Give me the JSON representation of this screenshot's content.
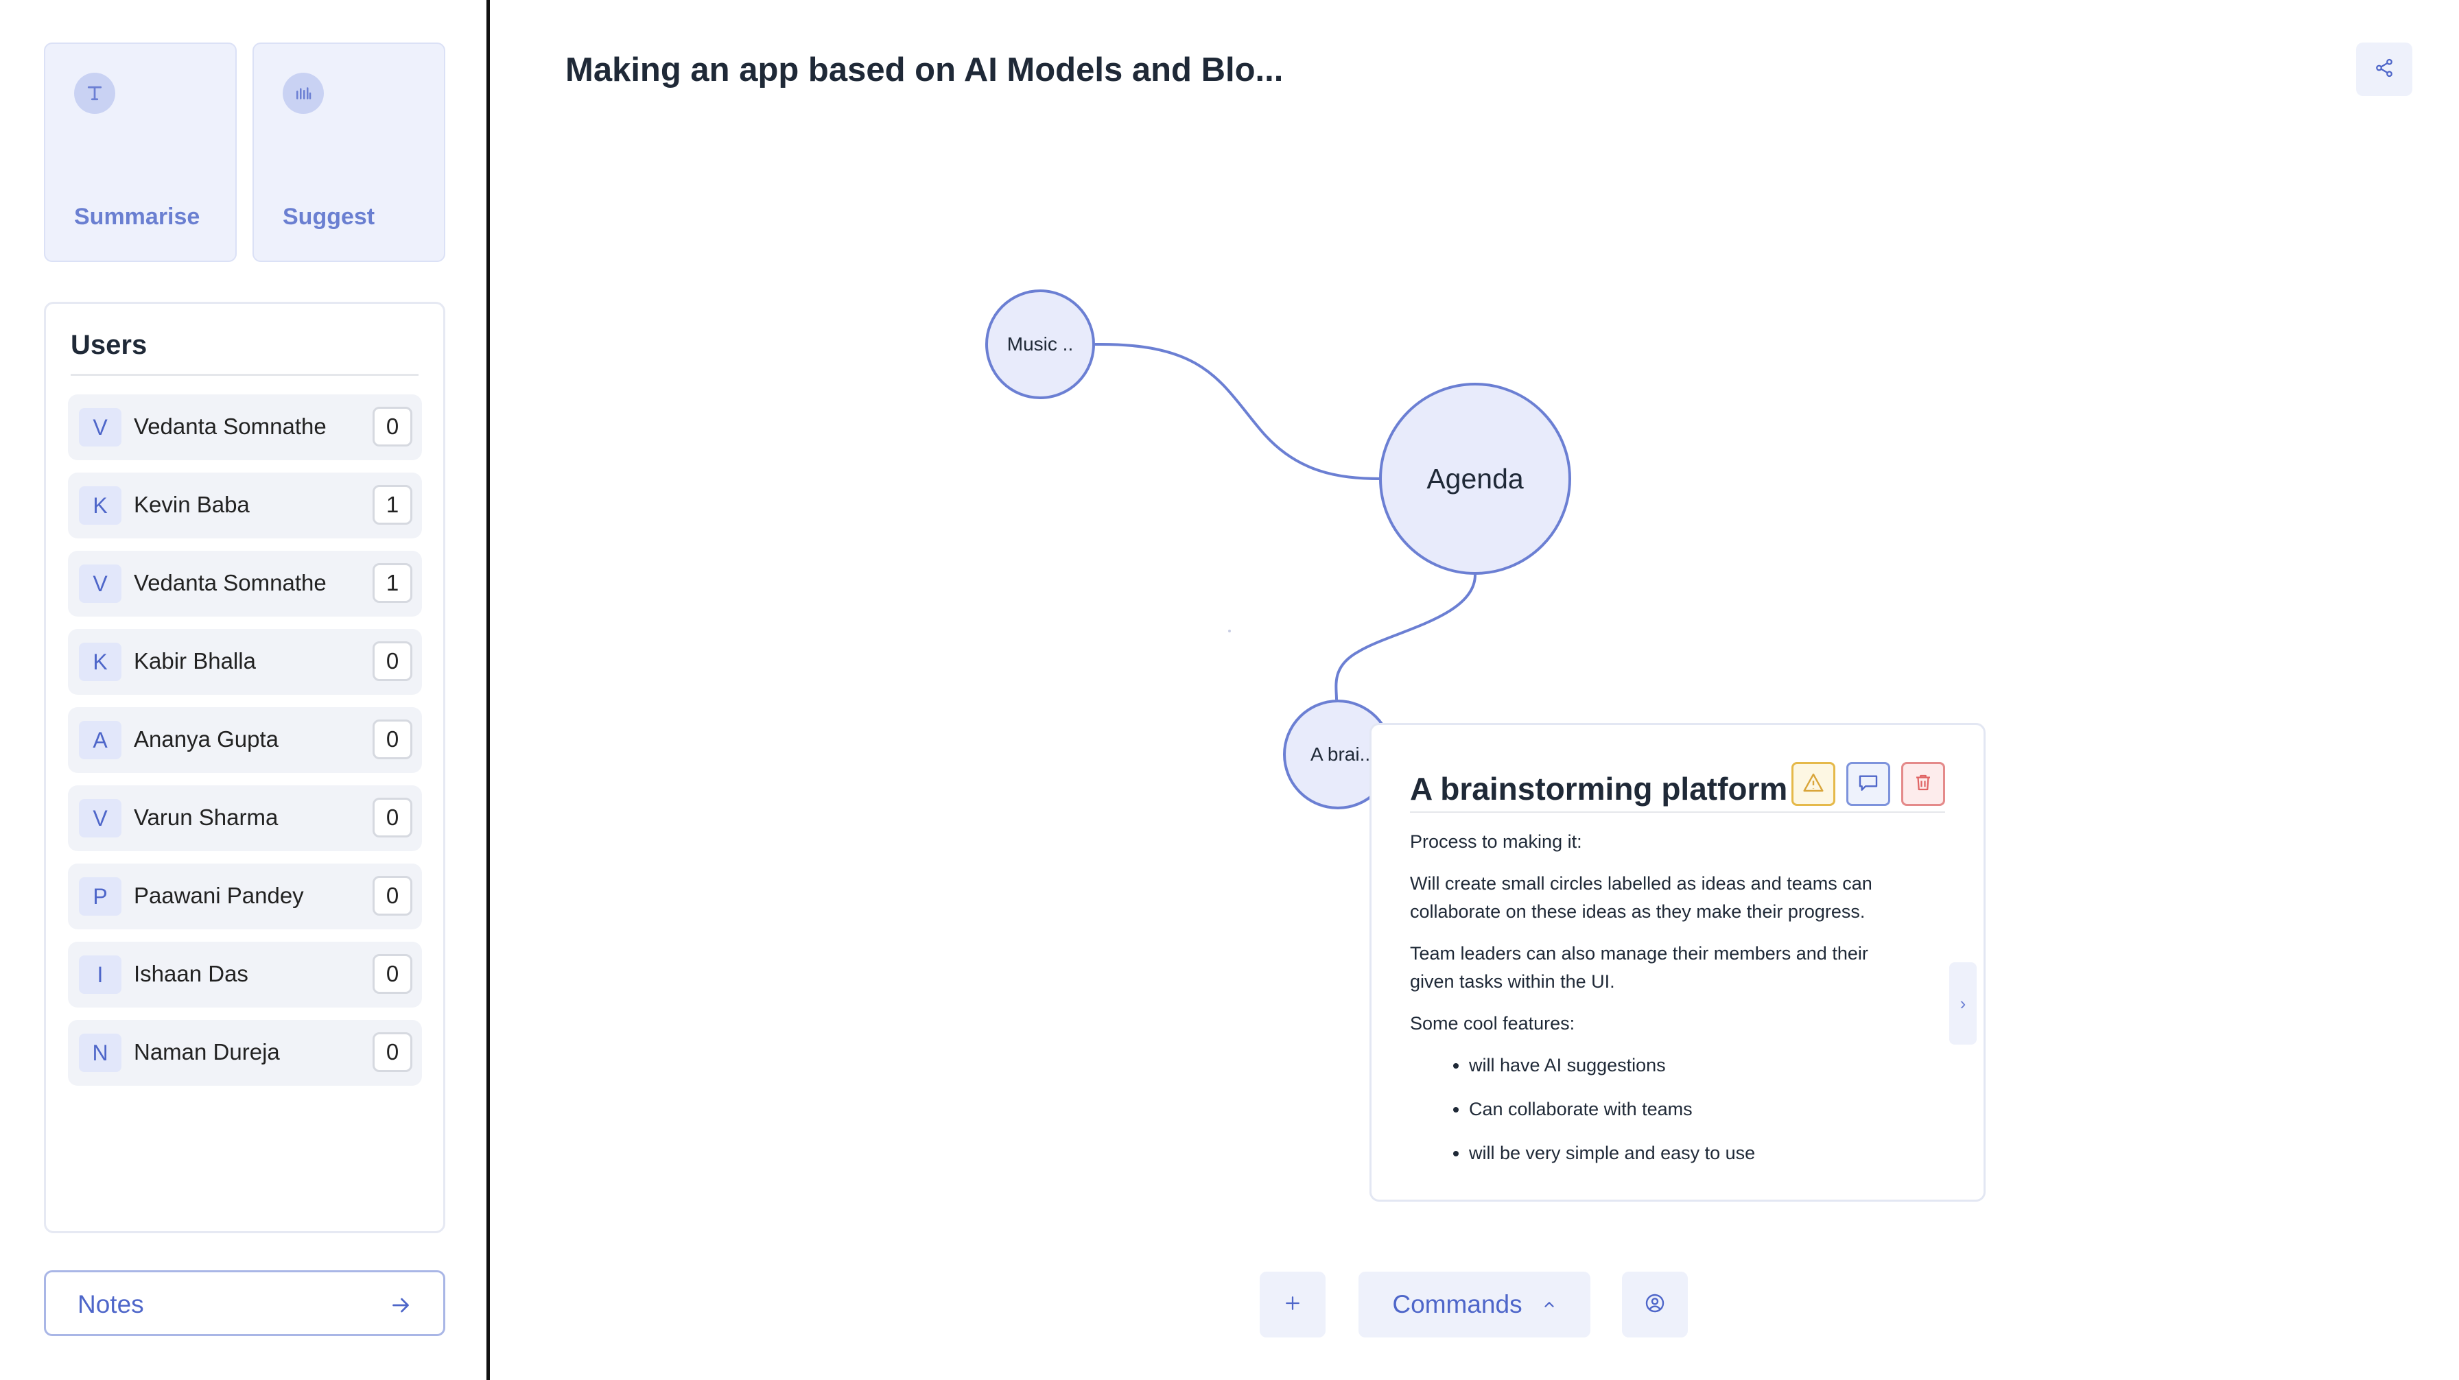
{
  "sidebar": {
    "actions": [
      {
        "label": "Summarise",
        "icon": "text-icon"
      },
      {
        "label": "Suggest",
        "icon": "bars-icon"
      }
    ],
    "users_title": "Users",
    "users": [
      {
        "initial": "V",
        "name": "Vedanta Somnathe",
        "count": "0"
      },
      {
        "initial": "K",
        "name": "Kevin Baba",
        "count": "1"
      },
      {
        "initial": "V",
        "name": "Vedanta Somnathe",
        "count": "1"
      },
      {
        "initial": "K",
        "name": "Kabir Bhalla",
        "count": "0"
      },
      {
        "initial": "A",
        "name": "Ananya Gupta",
        "count": "0"
      },
      {
        "initial": "V",
        "name": "Varun Sharma",
        "count": "0"
      },
      {
        "initial": "P",
        "name": "Paawani Pandey",
        "count": "0"
      },
      {
        "initial": "I",
        "name": "Ishaan Das",
        "count": "0"
      },
      {
        "initial": "N",
        "name": "Naman Dureja",
        "count": "0"
      }
    ],
    "notes_label": "Notes"
  },
  "main": {
    "title": "Making an app based on AI Models and Blo...",
    "nodes": {
      "music": "Music ..",
      "agenda": "Agenda",
      "brainstorm": "A brai.."
    },
    "idea_card": {
      "title": "A brainstorming platform",
      "paragraphs": [
        "Process to making it:",
        "Will create small circles labelled as ideas and teams can collaborate on these ideas as they make their progress.",
        "Team leaders can also manage their members and their given tasks within the UI.",
        "Some cool features:"
      ],
      "features": [
        "will have AI suggestions",
        "Can collaborate with teams",
        "will be very simple and easy to use"
      ],
      "expand": "›"
    }
  },
  "toolbar": {
    "add": "+",
    "commands_label": "Commands"
  },
  "colors": {
    "accent": "#4e66c9",
    "node_fill": "#e8ebfb",
    "node_stroke": "#6b7fd3",
    "warn": "#e5b94a",
    "danger": "#e06464"
  }
}
